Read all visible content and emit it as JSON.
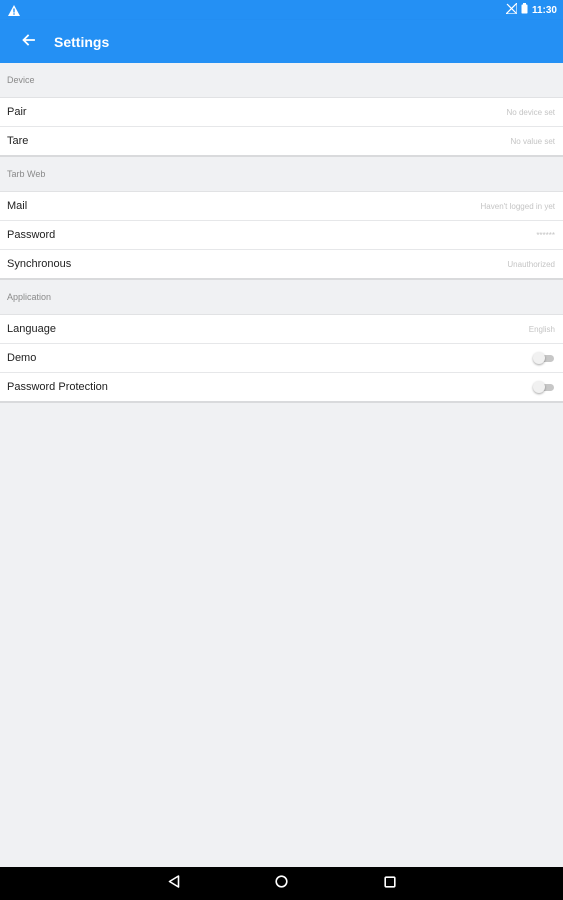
{
  "status_bar": {
    "time": "11:30",
    "icons": [
      "warning-icon",
      "signal-off-icon",
      "battery-icon"
    ]
  },
  "app_bar": {
    "title": "Settings",
    "back_icon": "arrow-back-icon"
  },
  "sections": {
    "device": {
      "header": "Device",
      "items": [
        {
          "label": "Pair",
          "value": "No device set"
        },
        {
          "label": "Tare",
          "value": "No value set"
        }
      ]
    },
    "tarb_web": {
      "header": "Tarb Web",
      "items": [
        {
          "label": "Mail",
          "value": "Haven't logged in yet"
        },
        {
          "label": "Password",
          "value": "******"
        },
        {
          "label": "Synchronous",
          "value": "Unauthorized"
        }
      ]
    },
    "application": {
      "header": "Application",
      "items": [
        {
          "label": "Language",
          "value": "English"
        },
        {
          "label": "Demo",
          "toggle": false
        },
        {
          "label": "Password Protection",
          "toggle": false
        }
      ]
    }
  },
  "nav_bar": {
    "buttons": [
      "back-triangle-icon",
      "home-circle-icon",
      "recents-square-icon"
    ]
  },
  "colors": {
    "accent": "#2490f4",
    "background": "#f0f1f3"
  }
}
